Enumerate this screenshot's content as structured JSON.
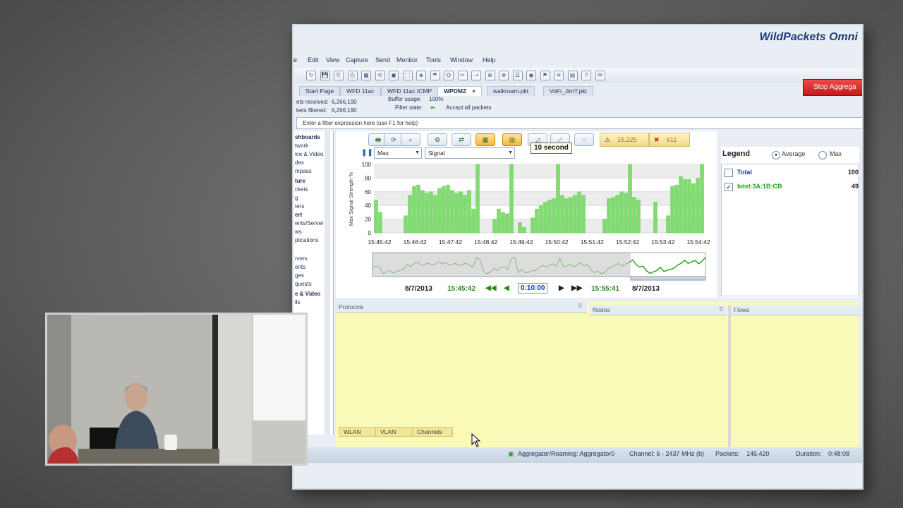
{
  "app": {
    "brand_text": "WildPackets Omni"
  },
  "menu": [
    "e",
    "Edit",
    "View",
    "Capture",
    "Send",
    "Monitor",
    "Tools",
    "Window",
    "Help"
  ],
  "tabs": [
    {
      "label": "Start Page"
    },
    {
      "label": "WFD 11ac"
    },
    {
      "label": "WFD 11ac ICMP"
    },
    {
      "label": "WPDMZ",
      "active": true,
      "close": "×"
    },
    {
      "label": "walkroam.pkt"
    },
    {
      "label": "VoFi_JimT.pkt"
    }
  ],
  "stop_button": "Stop Aggrega",
  "stats": {
    "received_label": "ets received:",
    "received_value": "6,266,190",
    "filtered_label": "kets filtered:",
    "filtered_value": "6,266,190",
    "buffer_label": "Buffer usage:",
    "buffer_value": "100%",
    "filter_label": "Filter state:",
    "filter_value": "Accept all packets"
  },
  "filter_placeholder": "Enter a filter expression here (use F1 for help)",
  "sidebar": [
    {
      "label": "shboards",
      "bold": true
    },
    {
      "label": "twork"
    },
    {
      "label": "ice & Video"
    },
    {
      "label": "dex"
    },
    {
      "label": "mpass"
    },
    {
      "label": "ture",
      "bold": true
    },
    {
      "label": "ckets"
    },
    {
      "label": "g"
    },
    {
      "label": "ters"
    },
    {
      "label": "ert",
      "bold": true
    },
    {
      "label": "ents/Server"
    },
    {
      "label": "ws"
    },
    {
      "label": "plications"
    },
    {
      "label": "rvers"
    },
    {
      "label": "ents"
    },
    {
      "label": "ges"
    },
    {
      "label": "quests"
    },
    {
      "label": "e & Video",
      "bold": true
    },
    {
      "label": "lls"
    }
  ],
  "chart_toolbar": {
    "alert1": "15,225",
    "alert2": "611"
  },
  "controls": {
    "mode": "Max",
    "metric": "Signal",
    "interval_tip": "10 second"
  },
  "chart_data": {
    "type": "bar",
    "ylabel": "Max Signal Strength %",
    "ylim": [
      0,
      100
    ],
    "yticks": [
      0,
      20,
      40,
      60,
      80,
      100
    ],
    "xticks": [
      "15:45:42",
      "15:46:42",
      "15:47:42",
      "15:48:42",
      "15:49:42",
      "15:50:42",
      "15:51:42",
      "15:52:42",
      "15:53:42",
      "15:54:42"
    ],
    "color": "#7fdc6e",
    "values": [
      48,
      30,
      0,
      0,
      0,
      0,
      0,
      25,
      55,
      68,
      70,
      62,
      58,
      60,
      55,
      65,
      68,
      70,
      62,
      58,
      60,
      55,
      62,
      35,
      100,
      0,
      0,
      0,
      20,
      35,
      30,
      28,
      100,
      0,
      15,
      8,
      0,
      22,
      35,
      40,
      45,
      48,
      50,
      100,
      55,
      50,
      52,
      55,
      60,
      55,
      0,
      0,
      0,
      0,
      20,
      50,
      52,
      55,
      60,
      58,
      100,
      52,
      48,
      0,
      0,
      0,
      45,
      0,
      0,
      25,
      68,
      70,
      82,
      78,
      78,
      72,
      80,
      100
    ]
  },
  "overview": {
    "start_date": "8/7/2013",
    "start_time": "15:45:42",
    "duration": "0:10:00",
    "end_time": "15:55:41",
    "end_date": "8/7/2013"
  },
  "legend": {
    "title": "Legend",
    "opt1": "Average",
    "opt2": "Max",
    "items": [
      {
        "name": "Total",
        "value": "100",
        "checked": false,
        "color": "#1c35c8"
      },
      {
        "name": "Intel:3A:1B:CB",
        "value": "49",
        "checked": true,
        "color": "#22a21a"
      }
    ]
  },
  "lower_headers": {
    "protocols": "Protocols",
    "nodes": "Nodes",
    "flows": "Flows",
    "count_a": "0",
    "count_b": "0"
  },
  "bottom_tabs": [
    "WLAN",
    "VLAN",
    "Channels"
  ],
  "status": {
    "adapter": "Aggregator/Roaming: Aggregator0",
    "channel": "Channel: 6 - 2437 MHz (b)",
    "packets_label": "Packets:",
    "packets_value": "145,420",
    "duration_label": "Duration:",
    "duration_value": "0:48:08"
  },
  "colors": {
    "accent": "#2d65b9",
    "alert_red": "#d42020",
    "graph_green": "#7fdc6e",
    "panel_yellow": "#fafab8"
  }
}
